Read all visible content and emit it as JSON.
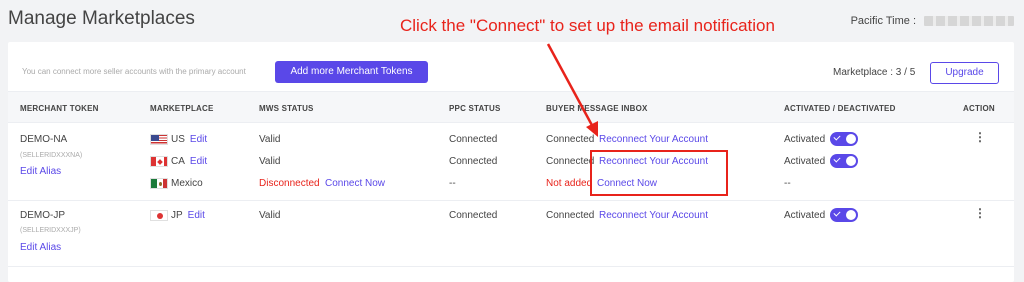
{
  "page_title": "Manage Marketplaces",
  "timezone_label": "Pacific Time :",
  "annotation": "Click the \"Connect\" to set up the email notification",
  "toolbar": {
    "hint": "You can connect more seller accounts with the primary account",
    "add_button": "Add more Merchant Tokens",
    "marketplace_count": "Marketplace : 3 / 5",
    "upgrade_button": "Upgrade"
  },
  "columns": [
    "MERCHANT TOKEN",
    "MARKETPLACE",
    "MWS STATUS",
    "PPC STATUS",
    "BUYER MESSAGE INBOX",
    "ACTIVATED / DEACTIVATED",
    "ACTION"
  ],
  "merchants": [
    {
      "name": "DEMO-NA",
      "seller_id": "(SELLERIDXXXNA)",
      "edit_alias": "Edit Alias",
      "rows": [
        {
          "flag": "us-flag-icon",
          "country": "US",
          "edit": "Edit",
          "mws": "Valid",
          "mws_action": "",
          "ppc": "Connected",
          "inbox_status": "Connected",
          "inbox_action": "Reconnect Your Account",
          "activated": "Activated"
        },
        {
          "flag": "ca-flag-icon",
          "country": "CA",
          "edit": "Edit",
          "mws": "Valid",
          "mws_action": "",
          "ppc": "Connected",
          "inbox_status": "Connected",
          "inbox_action": "Reconnect Your Account",
          "activated": "Activated"
        },
        {
          "flag": "mx-flag-icon",
          "country": "Mexico",
          "edit": "",
          "mws": "Disconnected",
          "mws_action": "Connect Now",
          "ppc": "--",
          "inbox_status": "Not added",
          "inbox_action": "Connect Now",
          "activated": "--"
        }
      ]
    },
    {
      "name": "DEMO-JP",
      "seller_id": "(SELLERIDXXXJP)",
      "edit_alias": "Edit Alias",
      "rows": [
        {
          "flag": "jp-flag-icon",
          "country": "JP",
          "edit": "Edit",
          "mws": "Valid",
          "mws_action": "",
          "ppc": "Connected",
          "inbox_status": "Connected",
          "inbox_action": "Reconnect Your Account",
          "activated": "Activated"
        }
      ]
    }
  ],
  "colors": {
    "accent": "#5a48e8",
    "annotation": "#e8231b",
    "error": "#e8231b"
  }
}
